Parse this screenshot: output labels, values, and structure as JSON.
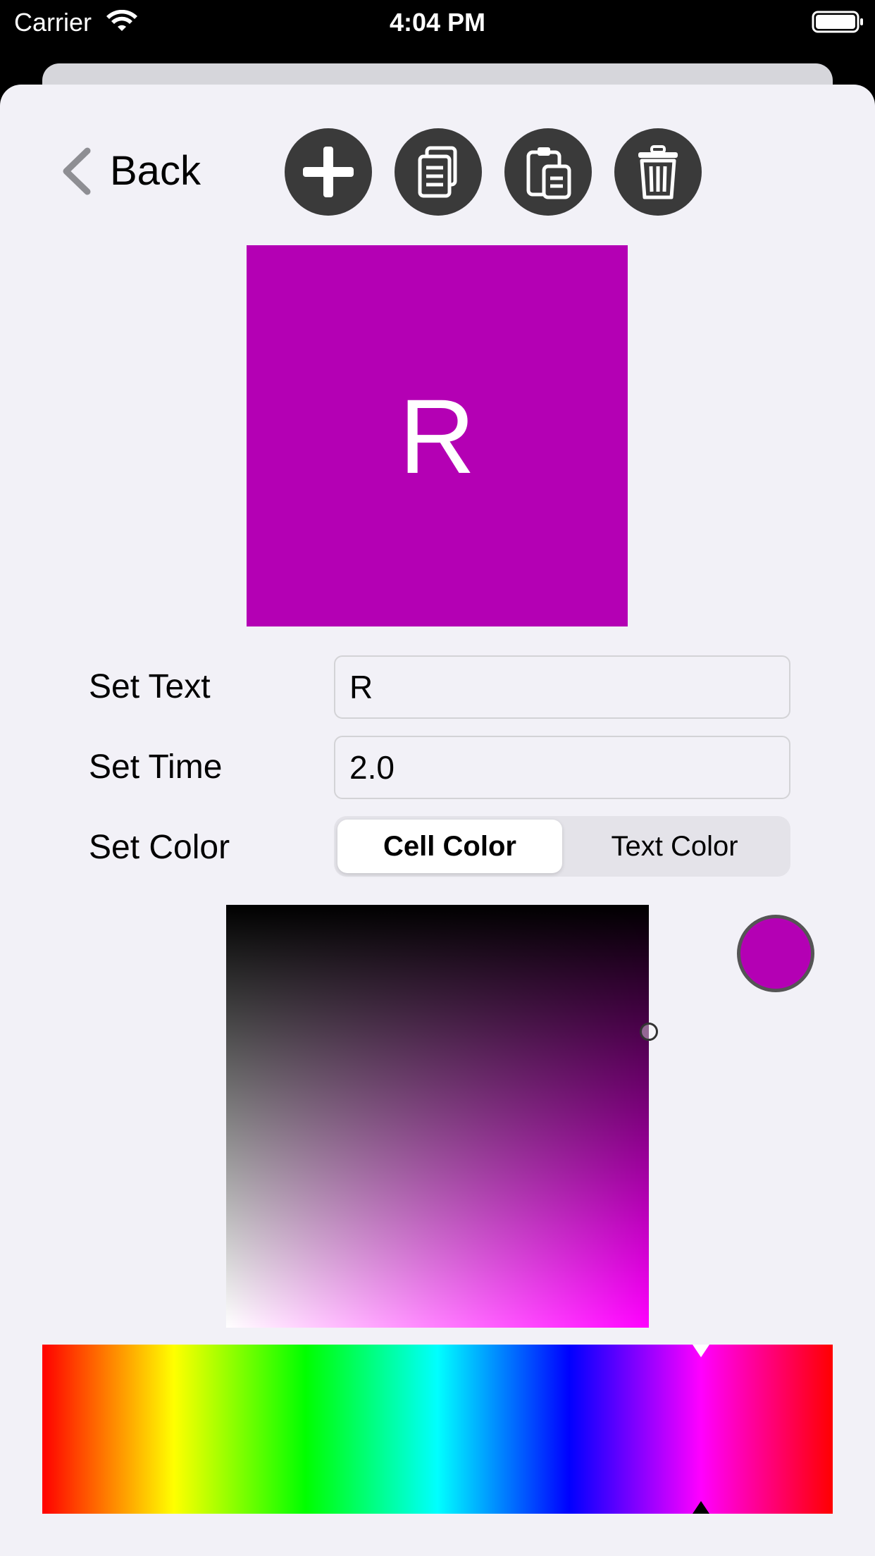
{
  "status_bar": {
    "carrier": "Carrier",
    "time": "4:04 PM",
    "wifi_icon": "wifi-icon",
    "battery_icon": "battery-icon"
  },
  "header": {
    "back_label": "Back",
    "back_icon": "chevron-left-icon",
    "toolbar": [
      {
        "name": "add-button",
        "icon": "plus-icon"
      },
      {
        "name": "copy-button",
        "icon": "copy-icon"
      },
      {
        "name": "paste-button",
        "icon": "paste-icon"
      },
      {
        "name": "delete-button",
        "icon": "trash-icon"
      }
    ]
  },
  "preview": {
    "text": "R",
    "cell_color": "#b400b4",
    "text_color": "#ffffff"
  },
  "form": {
    "set_text_label": "Set Text",
    "set_text_value": "R",
    "set_time_label": "Set Time",
    "set_time_value": "2.0",
    "set_color_label": "Set Color",
    "color_segments": [
      {
        "label": "Cell Color",
        "selected": true
      },
      {
        "label": "Text Color",
        "selected": false
      }
    ]
  },
  "color_picker": {
    "hue_degrees": 300,
    "saturation": 1.0,
    "brightness": 0.7,
    "selected_color": "#b400b4",
    "accent_color": "#ff00ff"
  },
  "colors": {
    "background": "#f2f1f7",
    "toolbar_button": "#3a3a3a",
    "chevron": "#8e8e93"
  }
}
